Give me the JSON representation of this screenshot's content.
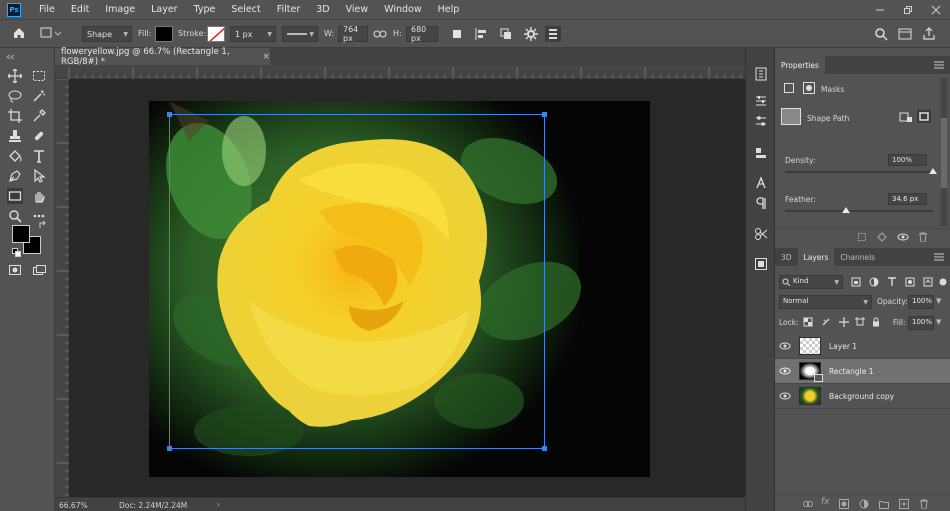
{
  "menubar": {
    "logo": "Ps",
    "items": [
      "File",
      "Edit",
      "Image",
      "Layer",
      "Type",
      "Select",
      "Filter",
      "3D",
      "View",
      "Window",
      "Help"
    ],
    "window_controls": [
      "minimize-icon",
      "restore-icon",
      "close-icon"
    ]
  },
  "options": {
    "shape_mode": "Shape",
    "fill_label": "Fill:",
    "stroke_label": "Stroke:",
    "stroke_width": "1 px",
    "w_label": "W:",
    "w_value": "764 px",
    "h_label": "H:",
    "h_value": "680 px"
  },
  "document": {
    "tab_title": "floweryellow.jpg @ 66.7% (Rectangle 1, RGB/8#) *",
    "tab_close": "×",
    "status_zoom": "66.67%",
    "status_doc": "Doc: 2.24M/2.24M"
  },
  "properties": {
    "title": "Properties",
    "masks_label": "Masks",
    "shape_path_label": "Shape Path",
    "density_label": "Density:",
    "density_value": "100%",
    "density_level": 1.0,
    "feather_label": "Feather:",
    "feather_value": "34.6 px",
    "feather_level": 0.41
  },
  "layers_panel": {
    "tabs": [
      "3D",
      "Layers",
      "Channels"
    ],
    "active_tab": "Layers",
    "filter_kind": "Kind",
    "blend_mode": "Normal",
    "opacity_label": "Opacity:",
    "opacity_value": "100%",
    "lock_label": "Lock:",
    "fill_label": "Fill:",
    "fill_value": "100%",
    "layers": [
      {
        "name": "Layer 1",
        "selected": false,
        "thumb": "transparent"
      },
      {
        "name": "Rectangle 1",
        "selected": true,
        "thumb": "mask"
      },
      {
        "name": "Background copy",
        "selected": false,
        "thumb": "photo"
      }
    ]
  },
  "colors": {
    "accent_selection": "#3b87e0",
    "panel_bg": "#535353",
    "canvas_bg": "#282828",
    "flower_yellow": "#f2d22a",
    "leaf_green": "#2f6b2a"
  }
}
